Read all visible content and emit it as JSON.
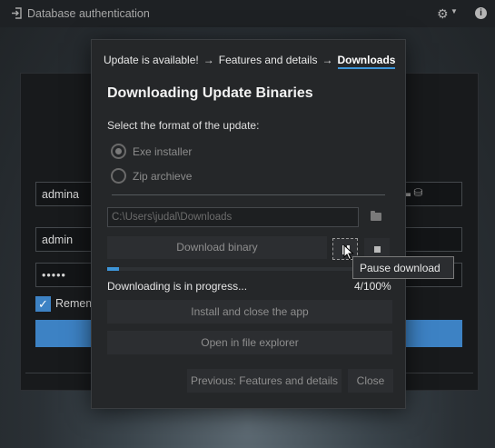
{
  "app": {
    "title": "Database authentication",
    "login_icon": "sign-in-icon",
    "settings_icon": "gear-icon",
    "info_icon": "info-icon"
  },
  "background_form": {
    "server_field": "admina",
    "username_field": "admin",
    "password_field": "•••••",
    "remember_label": "Remem",
    "remember_checked": true
  },
  "dialog": {
    "breadcrumbs": [
      {
        "label": "Update is available!",
        "active": false
      },
      {
        "label": "Features and details",
        "active": false
      },
      {
        "label": "Downloads",
        "active": true
      }
    ],
    "breadcrumb_separator": "→",
    "title": "Downloading Update Binaries",
    "format_prompt": "Select the format of the update:",
    "formats": [
      {
        "label": "Exe installer",
        "checked": true
      },
      {
        "label": "Zip archieve",
        "checked": false
      }
    ],
    "download_path": "C:\\Users\\judal\\Downloads",
    "download_button": "Download binary",
    "status_text": "Downloading is in progress...",
    "progress_text": "4/100%",
    "progress_fraction": 0.04,
    "install_button": "Install and close the app",
    "explorer_button": "Open in file explorer",
    "previous_button": "Previous: Features and details",
    "close_button": "Close"
  },
  "tooltip": {
    "text": "Pause download"
  },
  "colors": {
    "accent": "#3d95d8",
    "checkbox": "#3d82c4"
  }
}
